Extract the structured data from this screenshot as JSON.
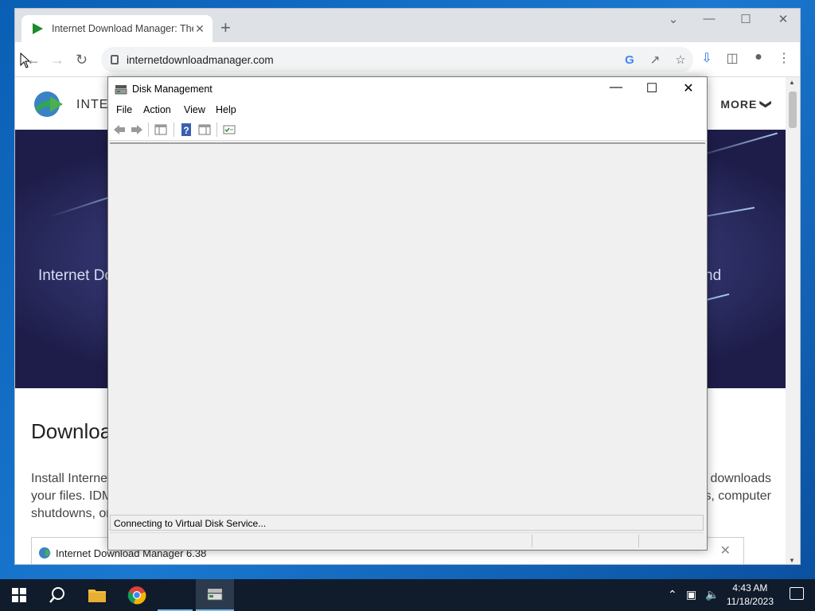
{
  "browser": {
    "tab_title": "Internet Download Manager: The",
    "tab_close": "✕",
    "new_tab": "+",
    "url": "internetdownloadmanager.com",
    "win_controls": [
      "⌄",
      "—",
      "☐",
      "✕"
    ]
  },
  "site": {
    "name": "INTER",
    "more": "MORE",
    "more_chevron": "❯",
    "hero_left": "Internet Do",
    "hero_right": "nd",
    "download_title": "Downloa",
    "para_line1_left": "Install Interne",
    "para_line1_right": "downloads",
    "para_line2_left": "your files. IDM",
    "para_line2_right": "s, computer",
    "para_line3_left": "shutdowns, or",
    "inner_title": "Internet Download Manager 6.38",
    "inner_close": "✕"
  },
  "disk_mgmt": {
    "title": "Disk Management",
    "menu": [
      "File",
      "Action",
      "View",
      "Help"
    ],
    "status": "Connecting to Virtual Disk Service...",
    "controls": {
      "minimize": "—",
      "maximize": "☐",
      "close": "✕"
    }
  },
  "taskbar": {
    "time": "4:43 AM",
    "date": "11/18/2023"
  },
  "colors": {
    "accent": "#0a5fb4",
    "chrome_tabstrip": "#dee1e6",
    "taskbar": "#101c2c"
  }
}
